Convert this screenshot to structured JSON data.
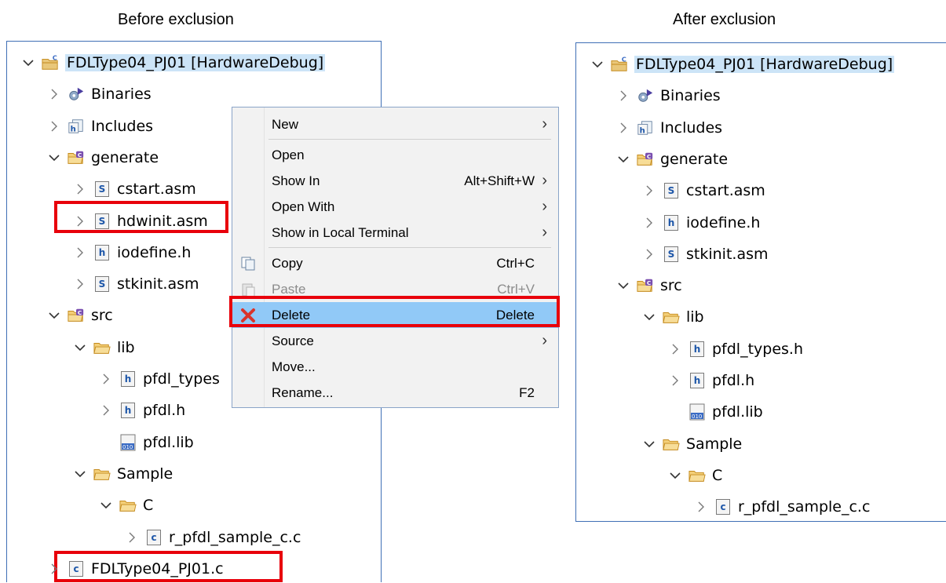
{
  "captions": {
    "before": "Before exclusion",
    "after": "After exclusion"
  },
  "colors": {
    "highlight": "#e8000b",
    "selected_menu": "#91c9f7",
    "panel_border": "#3f6fb5"
  },
  "before_tree": [
    {
      "label": "FDLType04_PJ01 [HardwareDebug]",
      "icon": "c-project-icon",
      "twisty": "expanded",
      "selected": true
    },
    {
      "label": "Binaries",
      "icon": "binaries-icon",
      "twisty": "collapsed"
    },
    {
      "label": "Includes",
      "icon": "includes-icon",
      "twisty": "collapsed"
    },
    {
      "label": "generate",
      "icon": "source-folder-icon",
      "twisty": "expanded"
    },
    {
      "label": "cstart.asm",
      "icon": "asm-file-icon",
      "twisty": "collapsed"
    },
    {
      "label": "hdwinit.asm",
      "icon": "asm-file-icon",
      "twisty": "collapsed"
    },
    {
      "label": "iodefine.h",
      "icon": "header-file-icon",
      "twisty": "collapsed"
    },
    {
      "label": "stkinit.asm",
      "icon": "asm-file-icon",
      "twisty": "collapsed"
    },
    {
      "label": "src",
      "icon": "source-folder-icon",
      "twisty": "expanded"
    },
    {
      "label": "lib",
      "icon": "folder-icon",
      "twisty": "expanded"
    },
    {
      "label": "pfdl_types",
      "icon": "header-file-icon",
      "twisty": "collapsed"
    },
    {
      "label": "pfdl.h",
      "icon": "header-file-icon",
      "twisty": "collapsed"
    },
    {
      "label": "pfdl.lib",
      "icon": "lib-file-icon",
      "twisty": "none"
    },
    {
      "label": "Sample",
      "icon": "folder-icon",
      "twisty": "expanded"
    },
    {
      "label": "C",
      "icon": "folder-icon",
      "twisty": "expanded"
    },
    {
      "label": "r_pfdl_sample_c.c",
      "icon": "c-file-icon",
      "twisty": "collapsed"
    },
    {
      "label": "FDLType04_PJ01.c",
      "icon": "c-file-icon",
      "twisty": "collapsed"
    }
  ],
  "after_tree": [
    {
      "label": "FDLType04_PJ01 [HardwareDebug]",
      "icon": "c-project-icon",
      "twisty": "expanded",
      "selected": true
    },
    {
      "label": "Binaries",
      "icon": "binaries-icon",
      "twisty": "collapsed"
    },
    {
      "label": "Includes",
      "icon": "includes-icon",
      "twisty": "collapsed"
    },
    {
      "label": "generate",
      "icon": "source-folder-icon",
      "twisty": "expanded"
    },
    {
      "label": "cstart.asm",
      "icon": "asm-file-icon",
      "twisty": "collapsed"
    },
    {
      "label": "iodefine.h",
      "icon": "header-file-icon",
      "twisty": "collapsed"
    },
    {
      "label": "stkinit.asm",
      "icon": "asm-file-icon",
      "twisty": "collapsed"
    },
    {
      "label": "src",
      "icon": "source-folder-icon",
      "twisty": "expanded"
    },
    {
      "label": "lib",
      "icon": "folder-icon",
      "twisty": "expanded"
    },
    {
      "label": "pfdl_types.h",
      "icon": "header-file-icon",
      "twisty": "collapsed"
    },
    {
      "label": "pfdl.h",
      "icon": "header-file-icon",
      "twisty": "collapsed"
    },
    {
      "label": "pfdl.lib",
      "icon": "lib-file-icon",
      "twisty": "none"
    },
    {
      "label": "Sample",
      "icon": "folder-icon",
      "twisty": "expanded"
    },
    {
      "label": "C",
      "icon": "folder-icon",
      "twisty": "expanded"
    },
    {
      "label": "r_pfdl_sample_c.c",
      "icon": "c-file-icon",
      "twisty": "collapsed"
    }
  ],
  "context_menu": [
    {
      "label": "New",
      "accel": "",
      "submenu": true
    },
    {
      "separator": true
    },
    {
      "label": "Open",
      "accel": "",
      "submenu": false
    },
    {
      "label": "Show In",
      "accel": "Alt+Shift+W",
      "submenu": true
    },
    {
      "label": "Open With",
      "accel": "",
      "submenu": true
    },
    {
      "label": "Show in Local Terminal",
      "accel": "",
      "submenu": true
    },
    {
      "separator": true
    },
    {
      "label": "Copy",
      "accel": "Ctrl+C",
      "submenu": false,
      "icon": "copy-icon"
    },
    {
      "label": "Paste",
      "accel": "Ctrl+V",
      "submenu": false,
      "icon": "paste-icon",
      "disabled": true
    },
    {
      "label": "Delete",
      "accel": "Delete",
      "submenu": false,
      "icon": "delete-icon",
      "selected": true
    },
    {
      "label": "Source",
      "accel": "",
      "submenu": true
    },
    {
      "label": "Move...",
      "accel": "",
      "submenu": false
    },
    {
      "label": "Rename...",
      "accel": "F2",
      "submenu": false
    }
  ]
}
